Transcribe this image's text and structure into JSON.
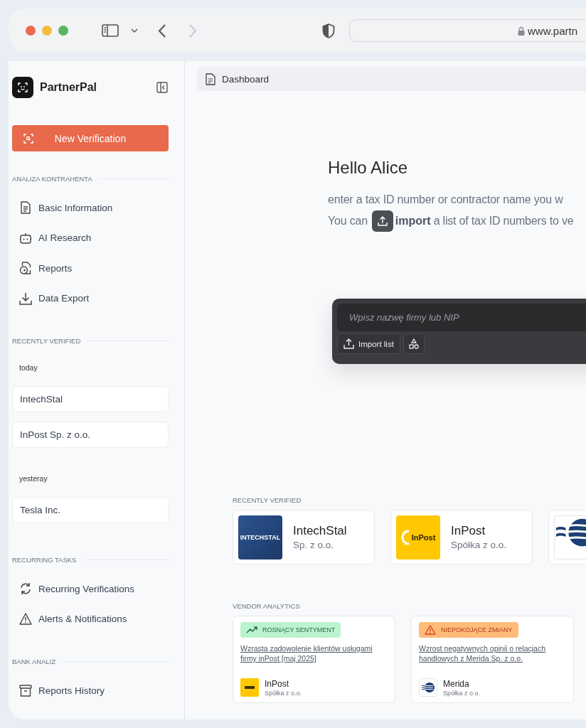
{
  "browser": {
    "url": "www.partn"
  },
  "sidebar": {
    "app_name": "PartnerPal",
    "primary_button": "New Verification",
    "blocks": [
      {
        "kind": "nav",
        "title": "ANALIZA KONTRAHENTA",
        "items": [
          {
            "label": "Basic Information"
          },
          {
            "label": "AI Research"
          },
          {
            "label": "Reports"
          },
          {
            "label": "Data Export"
          }
        ]
      },
      {
        "kind": "recent",
        "title": "RECENTLY VERIFIED",
        "groups": [
          {
            "date": "today",
            "items": [
              "IntechStal",
              "InPost Sp. z o.o."
            ]
          },
          {
            "date": "yesteray",
            "items": [
              "Tesla Inc."
            ]
          }
        ]
      },
      {
        "kind": "nav",
        "title": "RECURRING TASKS",
        "items": [
          {
            "label": "Recurring Verifications"
          },
          {
            "label": "Alerts & Notifications"
          }
        ]
      },
      {
        "kind": "nav",
        "title": "BANK ANALIZ",
        "items": [
          {
            "label": "Reports History"
          }
        ]
      }
    ]
  },
  "breadcrumb": "Dashboard",
  "hero": {
    "greeting": "Hello Alice",
    "line_1": "enter a tax ID number or contractor name you w",
    "line_2_start": "You can",
    "line_2_link": "import",
    "line_2_end": "a list of tax ID numbers to ve"
  },
  "search": {
    "placeholder": "Wpisz nazwę firmy lub NIP",
    "import_button": "Import list"
  },
  "recently_verified": {
    "title": "RECENTLY VERIFIED",
    "cards": [
      {
        "kind": "intechstal",
        "logo_text": "INTECHSTAL",
        "name": "IntechStal",
        "subtitle": "Sp. z o.o."
      },
      {
        "kind": "inpost",
        "logo_text": "InPost",
        "name": "InPost",
        "subtitle": "Spółka z o.o."
      },
      {
        "kind": "merida"
      }
    ]
  },
  "vendor_analytics": {
    "title": "VENDOR ANALYTICS",
    "cards": [
      {
        "kind": "positive",
        "tag": "ROSNĄCY SENTYMENT",
        "headline": "Wzrasta zadowolenie klientów usługami firmy inPost [maj 2025]",
        "company": {
          "kind": "inpost",
          "name": "InPost",
          "subtitle": "Spółka z o.o."
        }
      },
      {
        "kind": "warning",
        "tag": "NIEPOKOJĄCE ZMIANY",
        "headline": "Wzrost negatywnych opinii o relacjach handlowych z Merida Sp. z o.o.",
        "company": {
          "kind": "merida",
          "name": "Merida",
          "subtitle": "Spółka z o.o."
        }
      }
    ]
  }
}
